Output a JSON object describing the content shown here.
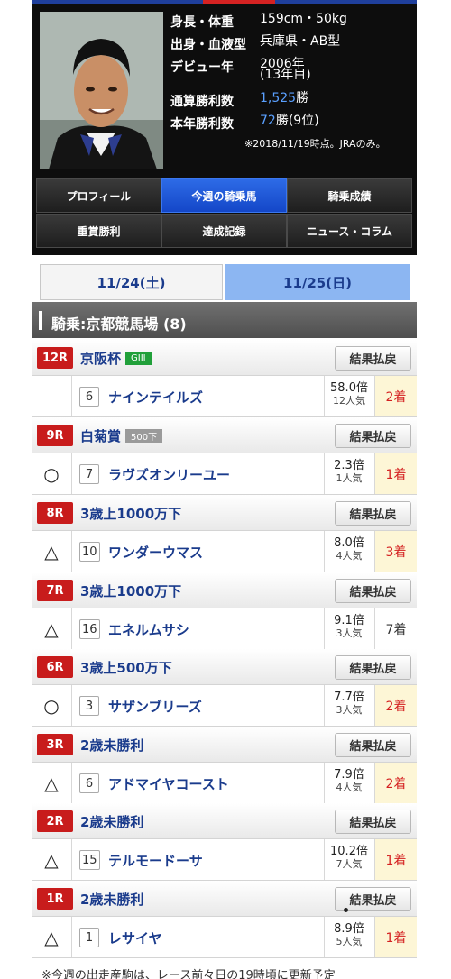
{
  "profile": {
    "rows": [
      {
        "label": "身長・体重",
        "value": "159cm・50kg"
      },
      {
        "label": "出身・血液型",
        "value": "兵庫県・AB型"
      },
      {
        "label": "デビュー年",
        "value": "2006年",
        "value2": "(13年目)"
      },
      {
        "label": "通算勝利数",
        "value_num": "1,525",
        "value_suffix": "勝"
      },
      {
        "label": "本年勝利数",
        "value_num": "72",
        "value_suffix": "勝(9位)"
      }
    ],
    "note": "※2018/11/19時点。JRAのみ。"
  },
  "nav_tabs": [
    {
      "label": "プロフィール",
      "active": false
    },
    {
      "label": "今週の騎乗馬",
      "active": true
    },
    {
      "label": "騎乗成績",
      "active": false
    },
    {
      "label": "重賞勝利",
      "active": false
    },
    {
      "label": "達成記録",
      "active": false
    },
    {
      "label": "ニュース・コラム",
      "active": false
    }
  ],
  "day_tabs": [
    {
      "label": "11/24(土)",
      "active": false
    },
    {
      "label": "11/25(日)",
      "active": true
    }
  ],
  "venue": {
    "title": "騎乗:京都競馬場 (8)"
  },
  "result_button_label": "結果払戻",
  "races": [
    {
      "num": "12R",
      "name": "京阪杯",
      "grade": "GIII",
      "grade_type": "g3",
      "horse": {
        "mark": "",
        "number": "6",
        "name": "ナインテイルズ",
        "odds": "58.0倍",
        "popularity": "12人気",
        "place": "2着",
        "hit": true
      }
    },
    {
      "num": "9R",
      "name": "白菊賞",
      "grade": "500下",
      "grade_type": "cond",
      "horse": {
        "mark": "○",
        "number": "7",
        "name": "ラヴズオンリーユー",
        "odds": "2.3倍",
        "popularity": "1人気",
        "place": "1着",
        "hit": true
      }
    },
    {
      "num": "8R",
      "name": "3歳上1000万下",
      "grade": "",
      "grade_type": "",
      "horse": {
        "mark": "△",
        "number": "10",
        "name": "ワンダーウマス",
        "odds": "8.0倍",
        "popularity": "4人気",
        "place": "3着",
        "hit": true
      }
    },
    {
      "num": "7R",
      "name": "3歳上1000万下",
      "grade": "",
      "grade_type": "",
      "horse": {
        "mark": "△",
        "number": "16",
        "name": "エネルムサシ",
        "odds": "9.1倍",
        "popularity": "3人気",
        "place": "7着",
        "hit": false
      }
    },
    {
      "num": "6R",
      "name": "3歳上500万下",
      "grade": "",
      "grade_type": "",
      "horse": {
        "mark": "○",
        "number": "3",
        "name": "サザンブリーズ",
        "odds": "7.7倍",
        "popularity": "3人気",
        "place": "2着",
        "hit": true
      }
    },
    {
      "num": "3R",
      "name": "2歳未勝利",
      "grade": "",
      "grade_type": "",
      "horse": {
        "mark": "△",
        "number": "6",
        "name": "アドマイヤコースト",
        "odds": "7.9倍",
        "popularity": "4人気",
        "place": "2着",
        "hit": true
      }
    },
    {
      "num": "2R",
      "name": "2歳未勝利",
      "grade": "",
      "grade_type": "",
      "horse": {
        "mark": "△",
        "number": "15",
        "name": "テルモードーサ",
        "odds": "10.2倍",
        "popularity": "7人気",
        "place": "1着",
        "hit": true
      }
    },
    {
      "num": "1R",
      "name": "2歳未勝利",
      "grade": "",
      "grade_type": "",
      "horse": {
        "mark": "△",
        "number": "1",
        "name": "レサイヤ",
        "odds": "8.9倍",
        "popularity": "5人気",
        "place": "1着",
        "hit": true
      }
    }
  ],
  "footer_note": "※今週の出走産駒は、レース前々日の19時頃に更新予定"
}
